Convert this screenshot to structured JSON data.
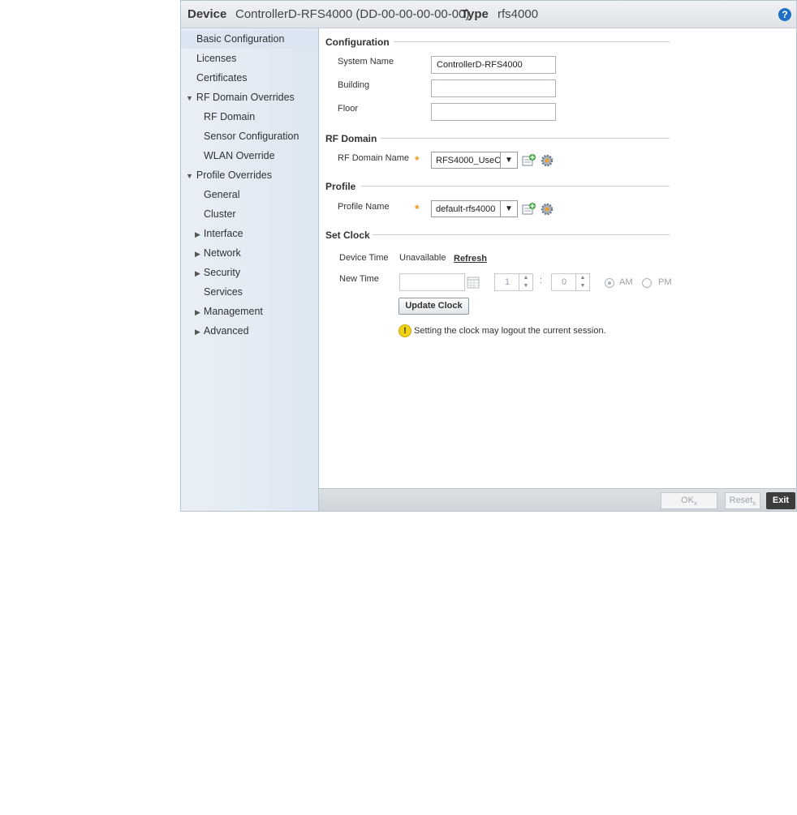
{
  "header": {
    "device_label": "Device",
    "device_value": "ControllerD-RFS4000 (DD-00-00-00-00-00)",
    "type_label": "Type",
    "type_value": "rfs4000",
    "help_icon": "?"
  },
  "sidebar": {
    "items": [
      {
        "label": "Basic Configuration"
      },
      {
        "label": "Licenses"
      },
      {
        "label": "Certificates"
      },
      {
        "label": "RF Domain Overrides"
      },
      {
        "label": "RF Domain"
      },
      {
        "label": "Sensor Configuration"
      },
      {
        "label": "WLAN Override"
      },
      {
        "label": "Profile Overrides"
      },
      {
        "label": "General"
      },
      {
        "label": "Cluster"
      },
      {
        "label": "Interface"
      },
      {
        "label": "Network"
      },
      {
        "label": "Security"
      },
      {
        "label": "Services"
      },
      {
        "label": "Management"
      },
      {
        "label": "Advanced"
      }
    ]
  },
  "configuration": {
    "title": "Configuration",
    "system_name_label": "System Name",
    "system_name_value": "ControllerD-RFS4000",
    "building_label": "Building",
    "building_value": "",
    "floor_label": "Floor",
    "floor_value": ""
  },
  "rf_domain": {
    "title": "RF Domain",
    "name_label": "RF Domain Name",
    "selected": "RFS4000_UseC"
  },
  "profile": {
    "title": "Profile",
    "name_label": "Profile Name",
    "selected": "default-rfs4000"
  },
  "set_clock": {
    "title": "Set Clock",
    "device_time_label": "Device Time",
    "device_time_value": "Unavailable",
    "refresh_label": "Refresh",
    "new_time_label": "New Time",
    "hour": "1",
    "separator": ":",
    "minute": "0",
    "am_label": "AM",
    "pm_label": "PM",
    "update_button": "Update Clock",
    "warning": "Setting the clock may logout the current session."
  },
  "footer": {
    "ok_label": "OK",
    "reset_label": "Reset",
    "exit_label": "Exit"
  }
}
